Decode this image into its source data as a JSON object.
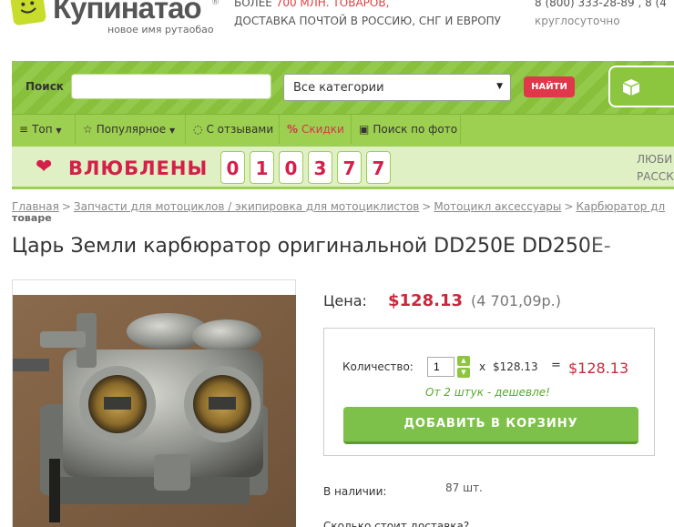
{
  "header": {
    "logo_name": "Купинатао",
    "logo_reg": "®",
    "logo_tagline": "новое имя рутаобао",
    "promo_line1_prefix": "БОЛЕЕ ",
    "promo_line1_highlight": "700 МЛН. ТОВАРОВ,",
    "promo_line2": "ДОСТАВКА ПОЧТОЙ В РОССИЮ, СНГ И ЕВРОПУ",
    "phone": "8 (800) 333-28-89 , 8 (4",
    "phone_hours": "круглосуточно"
  },
  "search": {
    "label": "Поиск",
    "input_value": "",
    "category_selected": "Все категории",
    "find_button": "НАЙТИ",
    "cart_icon": "cube-icon"
  },
  "nav": {
    "items": [
      {
        "label": "Топ",
        "icon": "list-icon",
        "dropdown": true
      },
      {
        "label": "Популярное",
        "icon": "star-icon",
        "dropdown": true
      },
      {
        "label": "С отзывами",
        "icon": "comment-icon",
        "dropdown": false
      },
      {
        "label": "Скидки",
        "icon": "percent-icon",
        "dropdown": false
      },
      {
        "label": "Поиск по фото",
        "icon": "photo-icon",
        "dropdown": false
      }
    ]
  },
  "counter": {
    "title": "ВЛЮБЛЕНЫ",
    "digits": [
      "0",
      "1",
      "0",
      "3",
      "7",
      "7"
    ],
    "right_line1": "ЛЮБИ",
    "right_line2": "РАССК"
  },
  "breadcrumb": {
    "items": [
      "Главная",
      "Запчасти для мотоциклов / экипировка для мотоциклистов",
      "Мотоцикл аксессуары",
      "Карбюратор дл"
    ],
    "separator": ">",
    "tail": "товаре"
  },
  "product": {
    "title": "Царь Земли карбюратор оригинальной DD250E DD250E-",
    "price_label": "Цена:",
    "price_usd": "$128.13",
    "price_rub": "(4 701,09р.)",
    "quantity_label": "Количество:",
    "quantity_value": "1",
    "times": "x",
    "unit_price": "$128.13",
    "equals": "=",
    "total": "$128.13",
    "discount_note": "От 2 штук - дешевле!",
    "add_to_cart": "ДОБАВИТЬ В КОРЗИНУ",
    "stock_label": "В наличии:",
    "stock_value": "87 шт.",
    "shipping_question": "Сколько стоит доставка?"
  },
  "colors": {
    "brand_green": "#8cc63e",
    "accent_red": "#c8283c",
    "button_red": "#e0384a"
  }
}
